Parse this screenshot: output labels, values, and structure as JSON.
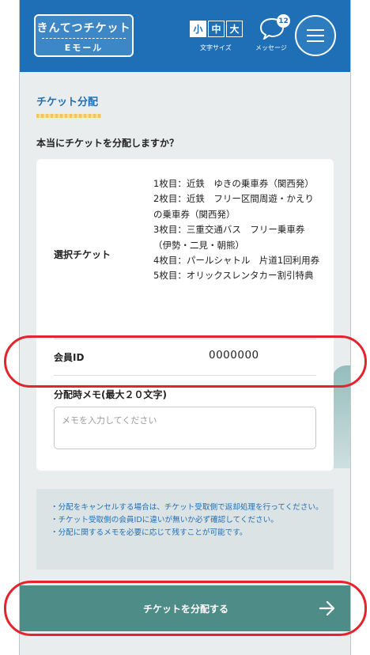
{
  "header": {
    "logo_line1": "きんてつチケット",
    "logo_line2": "Eモール",
    "font_size": {
      "small": "小",
      "medium": "中",
      "large": "大",
      "label": "文字サイズ",
      "selected": "small"
    },
    "messages": {
      "badge": "12",
      "label": "メッセージ"
    }
  },
  "page": {
    "section_title": "チケット分配",
    "question": "本当にチケットを分配しますか？"
  },
  "details": {
    "tickets_label": "選択チケット",
    "tickets": [
      "1枚目：近鉄　ゆきの乗車券（関西発）",
      "2枚目：近鉄　フリー区間周遊・かえりの乗車券（関西発）",
      "3枚目：三重交通バス　フリー乗車券（伊勢・二見・朝熊）",
      "4枚目：パールシャトル　片道1回利用券",
      "5枚目：オリックスレンタカー割引特典"
    ],
    "member_label": "会員ID",
    "member_value": "0000000",
    "memo_label": "分配時メモ(最大２０文字)",
    "memo_placeholder": "メモを入力してください",
    "memo_value": ""
  },
  "notes": [
    "・分配をキャンセルする場合は、チケット受取側で返却処理を行ってください。",
    "・チケット受取側の会員IDに違いが無いか必ず確認してください。",
    "・分配に関するメモを必要に応じて残すことが可能です。"
  ],
  "cta": {
    "label": "チケットを分配する",
    "icon": "arrow-right-icon"
  },
  "colors": {
    "header": "#1f6fb6",
    "accent_button": "#4e8c88",
    "highlight_ring": "#e4232c"
  }
}
